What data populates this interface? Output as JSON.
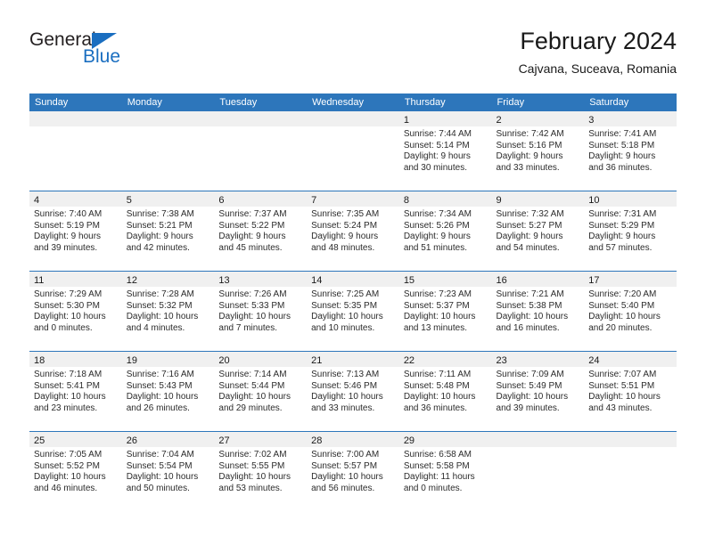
{
  "logo": {
    "primary_text": "General",
    "secondary_text": "Blue",
    "triangle_color": "#1a6ec0",
    "primary_color": "#231f20",
    "secondary_color": "#1a6ec0"
  },
  "header": {
    "title": "February 2024",
    "location": "Cajvana, Suceava, Romania"
  },
  "theme": {
    "header_bg": "#2d76bb",
    "header_text": "#ffffff",
    "day_number_bg": "#f0f0f0",
    "row_divider": "#2d76bb"
  },
  "weekdays": [
    "Sunday",
    "Monday",
    "Tuesday",
    "Wednesday",
    "Thursday",
    "Friday",
    "Saturday"
  ],
  "weeks": [
    [
      {
        "day": "",
        "sunrise": "",
        "sunset": "",
        "daylight_line1": "",
        "daylight_line2": ""
      },
      {
        "day": "",
        "sunrise": "",
        "sunset": "",
        "daylight_line1": "",
        "daylight_line2": ""
      },
      {
        "day": "",
        "sunrise": "",
        "sunset": "",
        "daylight_line1": "",
        "daylight_line2": ""
      },
      {
        "day": "",
        "sunrise": "",
        "sunset": "",
        "daylight_line1": "",
        "daylight_line2": ""
      },
      {
        "day": "1",
        "sunrise": "Sunrise: 7:44 AM",
        "sunset": "Sunset: 5:14 PM",
        "daylight_line1": "Daylight: 9 hours",
        "daylight_line2": "and 30 minutes."
      },
      {
        "day": "2",
        "sunrise": "Sunrise: 7:42 AM",
        "sunset": "Sunset: 5:16 PM",
        "daylight_line1": "Daylight: 9 hours",
        "daylight_line2": "and 33 minutes."
      },
      {
        "day": "3",
        "sunrise": "Sunrise: 7:41 AM",
        "sunset": "Sunset: 5:18 PM",
        "daylight_line1": "Daylight: 9 hours",
        "daylight_line2": "and 36 minutes."
      }
    ],
    [
      {
        "day": "4",
        "sunrise": "Sunrise: 7:40 AM",
        "sunset": "Sunset: 5:19 PM",
        "daylight_line1": "Daylight: 9 hours",
        "daylight_line2": "and 39 minutes."
      },
      {
        "day": "5",
        "sunrise": "Sunrise: 7:38 AM",
        "sunset": "Sunset: 5:21 PM",
        "daylight_line1": "Daylight: 9 hours",
        "daylight_line2": "and 42 minutes."
      },
      {
        "day": "6",
        "sunrise": "Sunrise: 7:37 AM",
        "sunset": "Sunset: 5:22 PM",
        "daylight_line1": "Daylight: 9 hours",
        "daylight_line2": "and 45 minutes."
      },
      {
        "day": "7",
        "sunrise": "Sunrise: 7:35 AM",
        "sunset": "Sunset: 5:24 PM",
        "daylight_line1": "Daylight: 9 hours",
        "daylight_line2": "and 48 minutes."
      },
      {
        "day": "8",
        "sunrise": "Sunrise: 7:34 AM",
        "sunset": "Sunset: 5:26 PM",
        "daylight_line1": "Daylight: 9 hours",
        "daylight_line2": "and 51 minutes."
      },
      {
        "day": "9",
        "sunrise": "Sunrise: 7:32 AM",
        "sunset": "Sunset: 5:27 PM",
        "daylight_line1": "Daylight: 9 hours",
        "daylight_line2": "and 54 minutes."
      },
      {
        "day": "10",
        "sunrise": "Sunrise: 7:31 AM",
        "sunset": "Sunset: 5:29 PM",
        "daylight_line1": "Daylight: 9 hours",
        "daylight_line2": "and 57 minutes."
      }
    ],
    [
      {
        "day": "11",
        "sunrise": "Sunrise: 7:29 AM",
        "sunset": "Sunset: 5:30 PM",
        "daylight_line1": "Daylight: 10 hours",
        "daylight_line2": "and 0 minutes."
      },
      {
        "day": "12",
        "sunrise": "Sunrise: 7:28 AM",
        "sunset": "Sunset: 5:32 PM",
        "daylight_line1": "Daylight: 10 hours",
        "daylight_line2": "and 4 minutes."
      },
      {
        "day": "13",
        "sunrise": "Sunrise: 7:26 AM",
        "sunset": "Sunset: 5:33 PM",
        "daylight_line1": "Daylight: 10 hours",
        "daylight_line2": "and 7 minutes."
      },
      {
        "day": "14",
        "sunrise": "Sunrise: 7:25 AM",
        "sunset": "Sunset: 5:35 PM",
        "daylight_line1": "Daylight: 10 hours",
        "daylight_line2": "and 10 minutes."
      },
      {
        "day": "15",
        "sunrise": "Sunrise: 7:23 AM",
        "sunset": "Sunset: 5:37 PM",
        "daylight_line1": "Daylight: 10 hours",
        "daylight_line2": "and 13 minutes."
      },
      {
        "day": "16",
        "sunrise": "Sunrise: 7:21 AM",
        "sunset": "Sunset: 5:38 PM",
        "daylight_line1": "Daylight: 10 hours",
        "daylight_line2": "and 16 minutes."
      },
      {
        "day": "17",
        "sunrise": "Sunrise: 7:20 AM",
        "sunset": "Sunset: 5:40 PM",
        "daylight_line1": "Daylight: 10 hours",
        "daylight_line2": "and 20 minutes."
      }
    ],
    [
      {
        "day": "18",
        "sunrise": "Sunrise: 7:18 AM",
        "sunset": "Sunset: 5:41 PM",
        "daylight_line1": "Daylight: 10 hours",
        "daylight_line2": "and 23 minutes."
      },
      {
        "day": "19",
        "sunrise": "Sunrise: 7:16 AM",
        "sunset": "Sunset: 5:43 PM",
        "daylight_line1": "Daylight: 10 hours",
        "daylight_line2": "and 26 minutes."
      },
      {
        "day": "20",
        "sunrise": "Sunrise: 7:14 AM",
        "sunset": "Sunset: 5:44 PM",
        "daylight_line1": "Daylight: 10 hours",
        "daylight_line2": "and 29 minutes."
      },
      {
        "day": "21",
        "sunrise": "Sunrise: 7:13 AM",
        "sunset": "Sunset: 5:46 PM",
        "daylight_line1": "Daylight: 10 hours",
        "daylight_line2": "and 33 minutes."
      },
      {
        "day": "22",
        "sunrise": "Sunrise: 7:11 AM",
        "sunset": "Sunset: 5:48 PM",
        "daylight_line1": "Daylight: 10 hours",
        "daylight_line2": "and 36 minutes."
      },
      {
        "day": "23",
        "sunrise": "Sunrise: 7:09 AM",
        "sunset": "Sunset: 5:49 PM",
        "daylight_line1": "Daylight: 10 hours",
        "daylight_line2": "and 39 minutes."
      },
      {
        "day": "24",
        "sunrise": "Sunrise: 7:07 AM",
        "sunset": "Sunset: 5:51 PM",
        "daylight_line1": "Daylight: 10 hours",
        "daylight_line2": "and 43 minutes."
      }
    ],
    [
      {
        "day": "25",
        "sunrise": "Sunrise: 7:05 AM",
        "sunset": "Sunset: 5:52 PM",
        "daylight_line1": "Daylight: 10 hours",
        "daylight_line2": "and 46 minutes."
      },
      {
        "day": "26",
        "sunrise": "Sunrise: 7:04 AM",
        "sunset": "Sunset: 5:54 PM",
        "daylight_line1": "Daylight: 10 hours",
        "daylight_line2": "and 50 minutes."
      },
      {
        "day": "27",
        "sunrise": "Sunrise: 7:02 AM",
        "sunset": "Sunset: 5:55 PM",
        "daylight_line1": "Daylight: 10 hours",
        "daylight_line2": "and 53 minutes."
      },
      {
        "day": "28",
        "sunrise": "Sunrise: 7:00 AM",
        "sunset": "Sunset: 5:57 PM",
        "daylight_line1": "Daylight: 10 hours",
        "daylight_line2": "and 56 minutes."
      },
      {
        "day": "29",
        "sunrise": "Sunrise: 6:58 AM",
        "sunset": "Sunset: 5:58 PM",
        "daylight_line1": "Daylight: 11 hours",
        "daylight_line2": "and 0 minutes."
      },
      {
        "day": "",
        "sunrise": "",
        "sunset": "",
        "daylight_line1": "",
        "daylight_line2": ""
      },
      {
        "day": "",
        "sunrise": "",
        "sunset": "",
        "daylight_line1": "",
        "daylight_line2": ""
      }
    ]
  ]
}
